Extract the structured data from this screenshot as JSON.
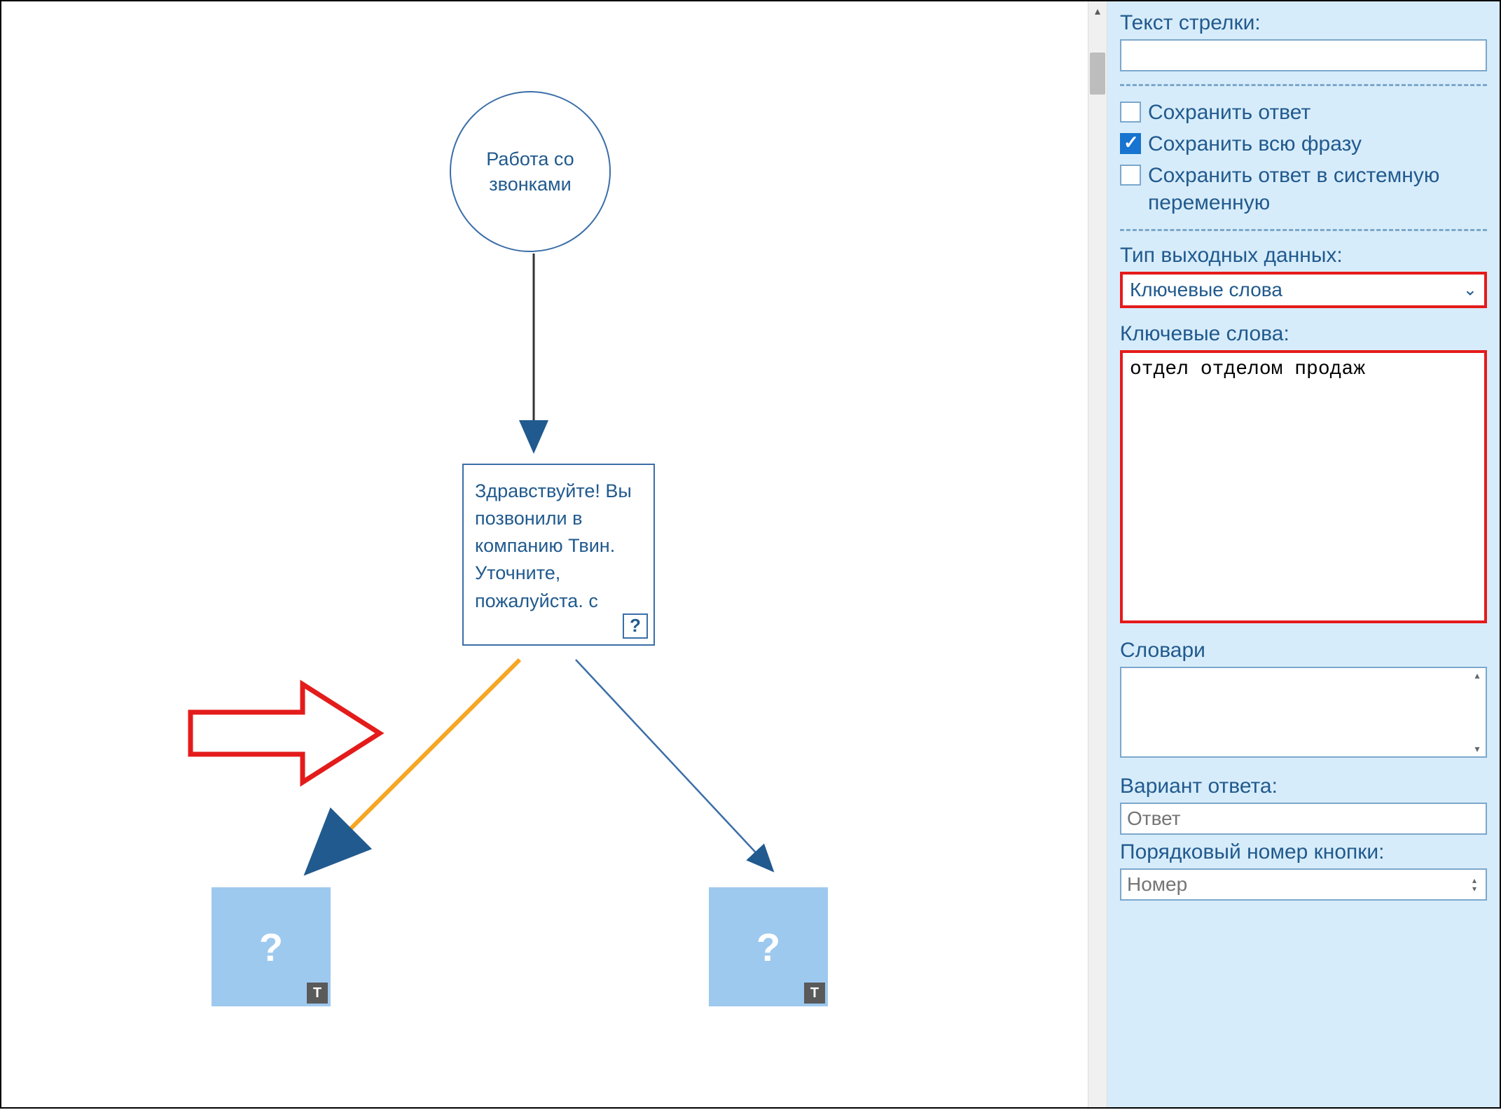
{
  "canvas": {
    "start_node_label": "Работа со звонками",
    "msg_node_text": "Здравствуйте! Вы позвонили в компанию Твин. Уточните, пожалуйста. с",
    "msg_node_badge": "?",
    "action_badge": "T",
    "action_qmark": "?",
    "highlight_arrow_present": true
  },
  "panel": {
    "arrow_text_label": "Текст стрелки:",
    "arrow_text_value": "",
    "save_answer_label": "Сохранить ответ",
    "save_answer_checked": false,
    "save_phrase_label": "Сохранить всю фразу",
    "save_phrase_checked": true,
    "save_sysvar_label": "Сохранить ответ в системную переменную",
    "save_sysvar_checked": false,
    "output_type_label": "Тип выходных данных:",
    "output_type_value": "Ключевые слова",
    "keywords_label": "Ключевые слова:",
    "keywords_value": "отдел отделом продаж",
    "dicts_label": "Словари",
    "answer_variant_label": "Вариант ответа:",
    "answer_variant_placeholder": "Ответ",
    "button_index_label": "Порядковый номер кнопки:",
    "button_index_placeholder": "Номер"
  }
}
